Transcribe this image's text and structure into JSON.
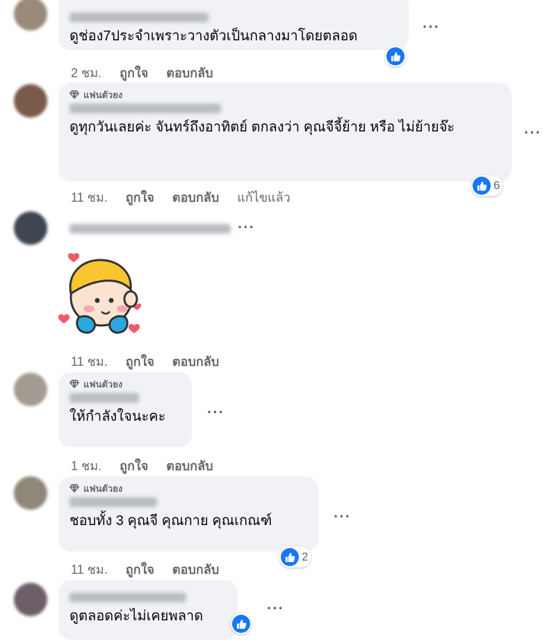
{
  "comments": [
    {
      "text": "ดูช่อง7ประจำเพราะวางตัวเป็นกลางมาโดยตลอด",
      "time": "2 ชม.",
      "like_label": "ถูกใจ",
      "reply_label": "ตอบกลับ",
      "reaction_count": "",
      "avatar_color": "#9a8a7a"
    },
    {
      "badge": "แฟนตัวยง",
      "text": "ดูทุกวันเลยค่ะ จันทร์ถึงอาทิตย์ ตกลงว่า คุณจีจี้ย้าย หรือ ไม่ย้ายจ๊ะ",
      "time": "11 ชม.",
      "like_label": "ถูกใจ",
      "reply_label": "ตอบกลับ",
      "edited_label": "แก้ไขแล้ว",
      "reaction_count": "6",
      "avatar_color": "#7a5a4a"
    },
    {
      "sticker": "boy-with-hearts-sticker",
      "time": "11 ชม.",
      "like_label": "ถูกใจ",
      "reply_label": "ตอบกลับ",
      "avatar_color": "#3e4652"
    },
    {
      "badge": "แฟนตัวยง",
      "text": "ให้กำลังใจนะคะ",
      "time": "1 ชม.",
      "like_label": "ถูกใจ",
      "reply_label": "ตอบกลับ",
      "avatar_color": "#a39a92"
    },
    {
      "badge": "แฟนตัวยง",
      "text": "ชอบทั้ง 3 คุณจี คุณกาย คุณเกณฑ์",
      "time": "11 ชม.",
      "like_label": "ถูกใจ",
      "reply_label": "ตอบกลับ",
      "reaction_count": "2",
      "avatar_color": "#8f8878"
    },
    {
      "text": "ดูตลอดค่ะไม่เคยพลาด",
      "avatar_color": "#6d5f6a"
    }
  ],
  "colors": {
    "bubble": "#f0f2f5",
    "meta_text": "#65676b",
    "like_blue": "#1877f2"
  },
  "icons": {
    "more": "more-horizontal-icon",
    "like": "thumbs-up-icon",
    "badge": "diamond-icon"
  }
}
